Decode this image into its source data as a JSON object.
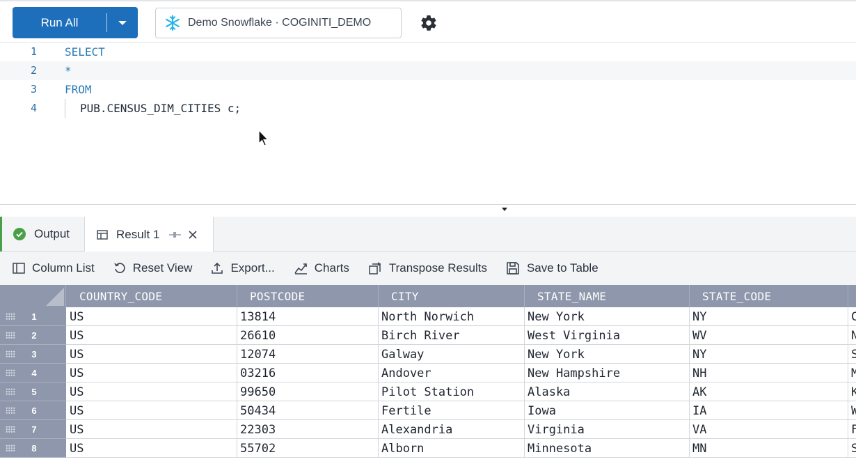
{
  "toolbar": {
    "run_label": "Run All",
    "connection_label": "Demo Snowflake · COGINITI_DEMO"
  },
  "editor": {
    "lines": [
      {
        "num": "1",
        "text": "SELECT"
      },
      {
        "num": "2",
        "text": "*"
      },
      {
        "num": "3",
        "text": "FROM"
      },
      {
        "num": "4",
        "text": "PUB.CENSUS_DIM_CITIES c;"
      }
    ]
  },
  "tabs": {
    "output": "Output",
    "result": "Result 1"
  },
  "result_tools": {
    "column_list": "Column List",
    "reset_view": "Reset View",
    "export": "Export...",
    "charts": "Charts",
    "transpose": "Transpose Results",
    "save_table": "Save to Table"
  },
  "grid": {
    "columns": [
      "COUNTRY_CODE",
      "POSTCODE",
      "CITY",
      "STATE_NAME",
      "STATE_CODE"
    ],
    "rows": [
      {
        "n": "1",
        "cells": [
          "US",
          "13814",
          "North Norwich",
          "New York",
          "NY",
          "C"
        ]
      },
      {
        "n": "2",
        "cells": [
          "US",
          "26610",
          "Birch River",
          "West Virginia",
          "WV",
          "N"
        ]
      },
      {
        "n": "3",
        "cells": [
          "US",
          "12074",
          "Galway",
          "New York",
          "NY",
          "S"
        ]
      },
      {
        "n": "4",
        "cells": [
          "US",
          "03216",
          "Andover",
          "New Hampshire",
          "NH",
          "M"
        ]
      },
      {
        "n": "5",
        "cells": [
          "US",
          "99650",
          "Pilot Station",
          "Alaska",
          "AK",
          "K"
        ]
      },
      {
        "n": "6",
        "cells": [
          "US",
          "50434",
          "Fertile",
          "Iowa",
          "IA",
          "W"
        ]
      },
      {
        "n": "7",
        "cells": [
          "US",
          "22303",
          "Alexandria",
          "Virginia",
          "VA",
          "F"
        ]
      },
      {
        "n": "8",
        "cells": [
          "US",
          "55702",
          "Alborn",
          "Minnesota",
          "MN",
          "S"
        ]
      }
    ]
  }
}
